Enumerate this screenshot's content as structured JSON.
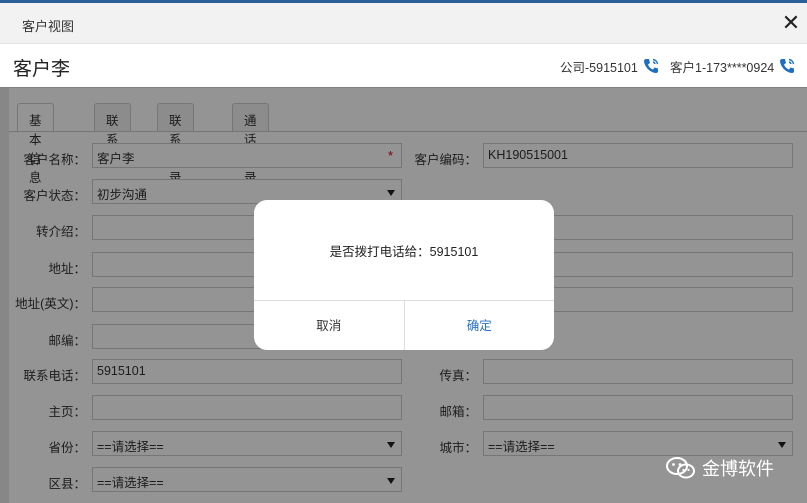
{
  "window": {
    "title": "客户视图",
    "close_glyph": "✕"
  },
  "customer": {
    "name": "客户李",
    "phones": [
      {
        "label": "公司-5915101",
        "icon": "phone-icon"
      },
      {
        "label": "客户1-173****0924",
        "icon": "phone-icon"
      }
    ]
  },
  "tabs": [
    {
      "label": "基本信息",
      "active": true
    },
    {
      "label": "联系人",
      "active": false
    },
    {
      "label": "联系记录",
      "active": false
    },
    {
      "label": "通话记录",
      "active": false
    }
  ],
  "form": {
    "customer_name": {
      "label": "客户名称：",
      "value": "客户李",
      "required_mark": "*"
    },
    "customer_code": {
      "label": "客户编码：",
      "value": "KH190515001"
    },
    "customer_status": {
      "label": "客户状态：",
      "value": "初步沟通"
    },
    "referral": {
      "label": "转介绍：",
      "value": ""
    },
    "address": {
      "label": "地址：",
      "value": ""
    },
    "address_en": {
      "label": "地址(英文)：",
      "value": ""
    },
    "postcode": {
      "label": "邮编：",
      "value": ""
    },
    "phone": {
      "label": "联系电话：",
      "value": "5915101"
    },
    "fax": {
      "label": "传真：",
      "value": ""
    },
    "homepage": {
      "label": "主页：",
      "value": ""
    },
    "email": {
      "label": "邮箱：",
      "value": ""
    },
    "province": {
      "label": "省份：",
      "value": "==请选择=="
    },
    "city": {
      "label": "城市：",
      "value": "==请选择=="
    },
    "district": {
      "label": "区县：",
      "value": "==请选择=="
    }
  },
  "dialog": {
    "message": "是否拨打电话给：5915101",
    "cancel_label": "取消",
    "confirm_label": "确定"
  },
  "watermark": {
    "text": "金博软件",
    "icon": "wechat-icon"
  },
  "colors": {
    "accent": "#2a73c4",
    "phone_icon": "#1e6fc2",
    "required": "#d10000"
  }
}
